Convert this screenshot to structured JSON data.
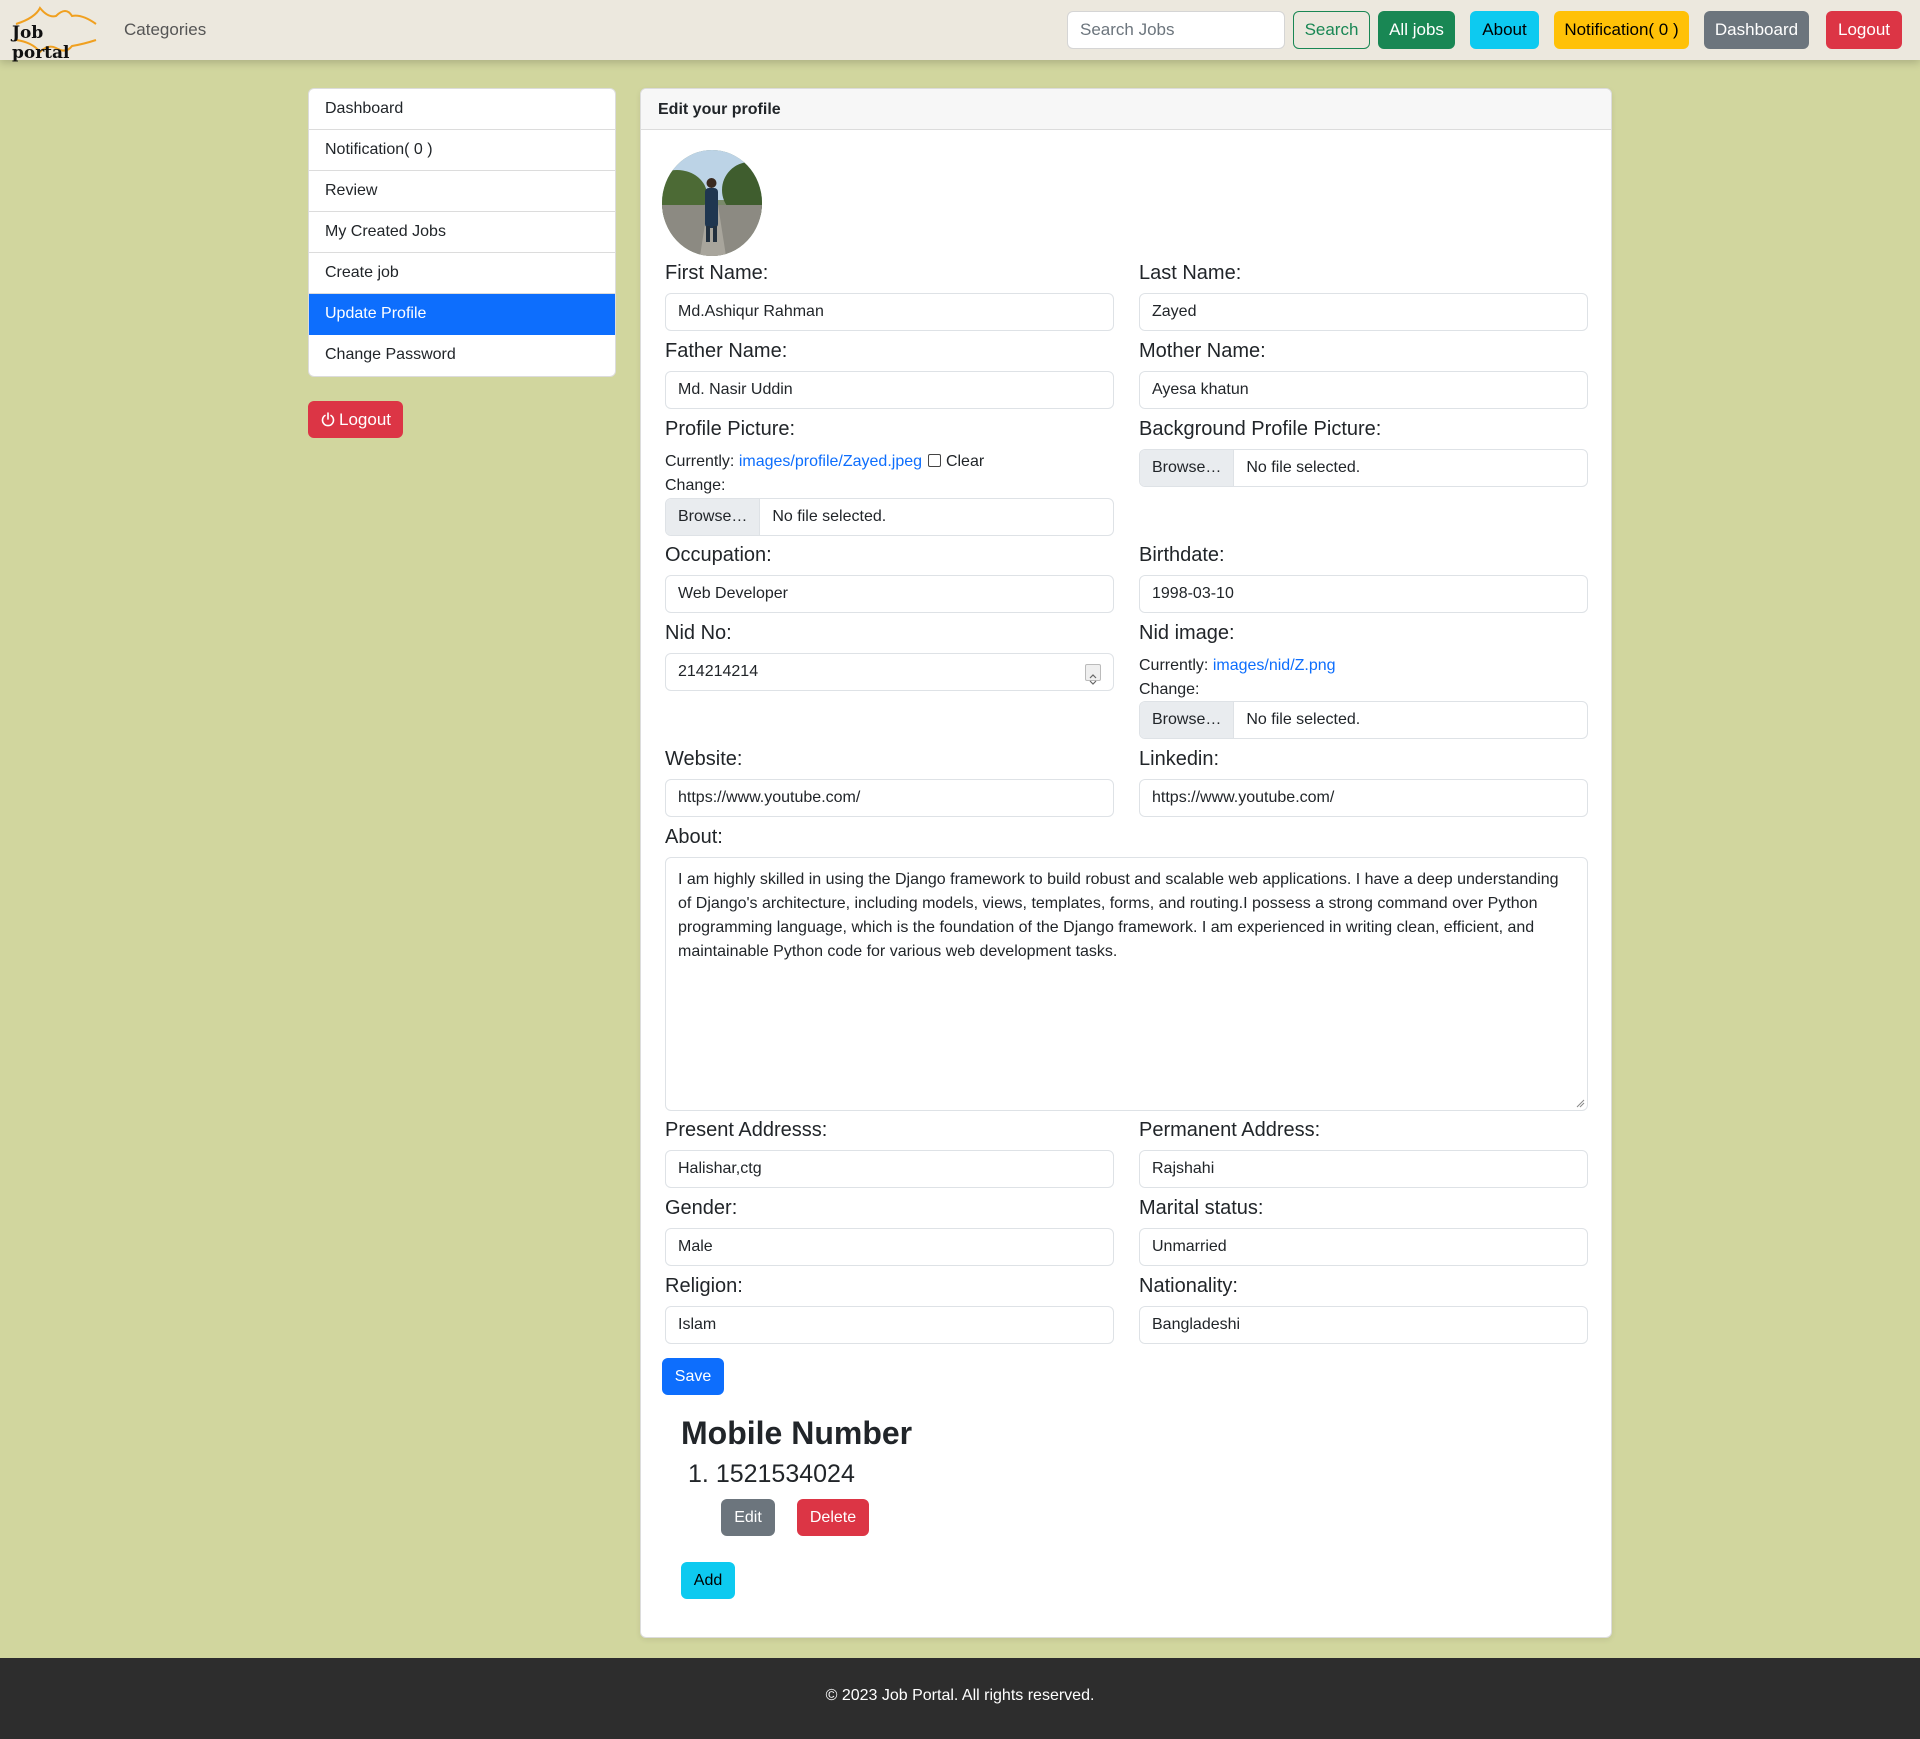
{
  "navbar": {
    "logo_text": "Job portal",
    "categories_label": "Categories",
    "search_placeholder": "Search Jobs",
    "search_button": "Search",
    "all_jobs_button": "All jobs",
    "about_button": "About",
    "notification_button": "Notification( 0 )",
    "dashboard_button": "Dashboard",
    "logout_button": "Logout"
  },
  "sidebar": {
    "items": [
      {
        "label": "Dashboard"
      },
      {
        "label": "Notification( 0 )"
      },
      {
        "label": "Review"
      },
      {
        "label": "My Created Jobs"
      },
      {
        "label": "Create job"
      },
      {
        "label": "Update Profile",
        "active": true
      },
      {
        "label": "Change Password"
      }
    ],
    "logout_label": "Logout"
  },
  "form": {
    "header": "Edit your profile",
    "first_name": {
      "label": "First Name:",
      "value": "Md.Ashiqur Rahman"
    },
    "last_name": {
      "label": "Last Name:",
      "value": "Zayed"
    },
    "father_name": {
      "label": "Father Name:",
      "value": "Md. Nasir Uddin"
    },
    "mother_name": {
      "label": "Mother Name:",
      "value": "Ayesa khatun"
    },
    "profile_picture": {
      "label": "Profile Picture:",
      "currently_label": "Currently:",
      "current_file": "images/profile/Zayed.jpeg",
      "clear_label": "Clear",
      "change_label": "Change:",
      "browse_label": "Browse…",
      "no_file_label": "No file selected."
    },
    "background_picture": {
      "label": "Background Profile Picture:",
      "browse_label": "Browse…",
      "no_file_label": "No file selected."
    },
    "occupation": {
      "label": "Occupation:",
      "value": "Web Developer"
    },
    "birthdate": {
      "label": "Birthdate:",
      "value": "1998-03-10"
    },
    "nid_no": {
      "label": "Nid No:",
      "value": "214214214"
    },
    "nid_image": {
      "label": "Nid image:",
      "currently_label": "Currently:",
      "current_file": "images/nid/Z.png",
      "change_label": "Change:",
      "browse_label": "Browse…",
      "no_file_label": "No file selected."
    },
    "website": {
      "label": "Website:",
      "value": "https://www.youtube.com/"
    },
    "linkedin": {
      "label": "Linkedin:",
      "value": "https://www.youtube.com/"
    },
    "about": {
      "label": "About:",
      "value": "I am highly skilled in using the Django framework to build robust and scalable web applications. I have a deep understanding of Django's architecture, including models, views, templates, forms, and routing.I possess a strong command over Python programming language, which is the foundation of the Django framework. I am experienced in writing clean, efficient, and maintainable Python code for various web development tasks."
    },
    "present_address": {
      "label": "Present Addresss:",
      "value": "Halishar,ctg"
    },
    "permanent_address": {
      "label": "Permanent Address:",
      "value": "Rajshahi"
    },
    "gender": {
      "label": "Gender:",
      "value": "Male"
    },
    "marital_status": {
      "label": "Marital status:",
      "value": "Unmarried"
    },
    "religion": {
      "label": "Religion:",
      "value": "Islam"
    },
    "nationality": {
      "label": "Nationality:",
      "value": "Bangladeshi"
    },
    "save_button": "Save"
  },
  "mobile": {
    "title": "Mobile Number",
    "numbers": [
      {
        "index": "1.",
        "number": "1521534024"
      }
    ],
    "edit_button": "Edit",
    "delete_button": "Delete",
    "add_button": "Add"
  },
  "footer": {
    "text": "© 2023 Job Portal. All rights reserved."
  },
  "colors": {
    "page_background": "#d1d69e",
    "navbar_background": "#ece8de",
    "primary": "#0d6efd",
    "success": "#198754",
    "info": "#0dcaf0",
    "warning": "#ffc107",
    "secondary": "#6c757d",
    "danger": "#dc3545",
    "footer_background": "#2d2d2d"
  }
}
